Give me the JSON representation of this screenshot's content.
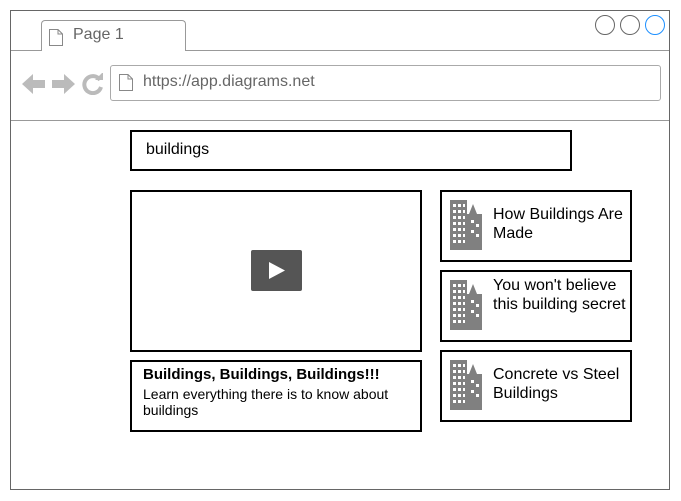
{
  "browser": {
    "tab_title": "Page 1",
    "url": "https://app.diagrams.net",
    "window_buttons": [
      "minimize-button",
      "maximize-button",
      "close-button"
    ]
  },
  "search": {
    "query": "buildings"
  },
  "video": {
    "title": "Buildings, Buildings, Buildings!!!",
    "description": "Learn everything there is to know about buildings"
  },
  "related": [
    {
      "title": "How Buildings Are Made",
      "icon": "building-icon"
    },
    {
      "title": "You won't believe this building secret",
      "icon": "building-icon"
    },
    {
      "title": "Concrete vs Steel Buildings",
      "icon": "building-icon"
    }
  ],
  "colors": {
    "icon_gray": "#808080",
    "play_bg": "#555555",
    "accent": "#1e90ff"
  }
}
